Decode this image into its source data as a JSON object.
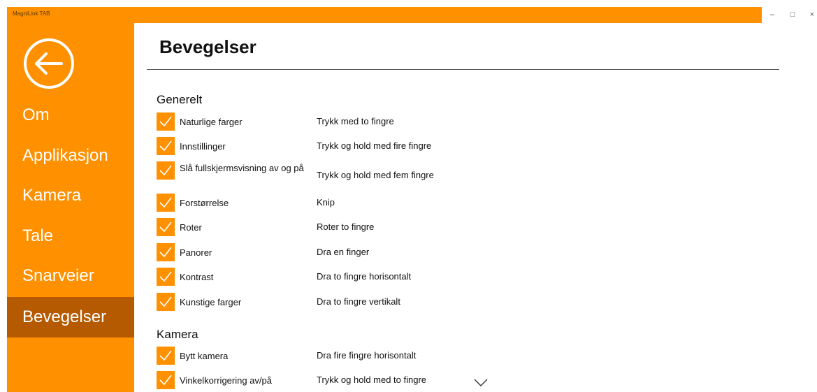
{
  "window": {
    "app_title": "MagniLink TAB",
    "minimize_glyph": "–",
    "maximize_glyph": "□",
    "close_glyph": "×"
  },
  "colors": {
    "accent": "#ff9000",
    "accent_dark": "#b55a00",
    "text": "#111111"
  },
  "sidebar": {
    "back_icon": "back-arrow-icon",
    "items": [
      {
        "label": "Om",
        "active": false
      },
      {
        "label": "Applikasjon",
        "active": false
      },
      {
        "label": "Kamera",
        "active": false
      },
      {
        "label": "Tale",
        "active": false
      },
      {
        "label": "Snarveier",
        "active": false
      },
      {
        "label": "Bevegelser",
        "active": true
      }
    ]
  },
  "main": {
    "title": "Bevegelser",
    "sections": [
      {
        "header": "Generelt",
        "rows": [
          {
            "label": "Naturlige farger",
            "gesture": "Trykk med to fingre",
            "checked": true
          },
          {
            "label": "Innstillinger",
            "gesture": "Trykk og hold med fire fingre",
            "checked": true
          },
          {
            "label": "Slå fullskjermsvisning av og på",
            "gesture": "Trykk og hold med fem fingre",
            "checked": true
          },
          {
            "label": "Forstørrelse",
            "gesture": "Knip",
            "checked": true
          },
          {
            "label": "Roter",
            "gesture": "Roter to fingre",
            "checked": true
          },
          {
            "label": "Panorer",
            "gesture": "Dra en finger",
            "checked": true
          },
          {
            "label": "Kontrast",
            "gesture": "Dra to fingre horisontalt",
            "checked": true
          },
          {
            "label": "Kunstige farger",
            "gesture": "Dra to fingre vertikalt",
            "checked": true
          }
        ]
      },
      {
        "header": "Kamera",
        "rows": [
          {
            "label": "Bytt kamera",
            "gesture": "Dra fire fingre horisontalt",
            "checked": true
          },
          {
            "label": "Vinkelkorrigering av/på",
            "gesture": "Trykk og hold med to fingre",
            "checked": true
          }
        ]
      }
    ],
    "scroll_icon": "chevron-down-icon"
  }
}
